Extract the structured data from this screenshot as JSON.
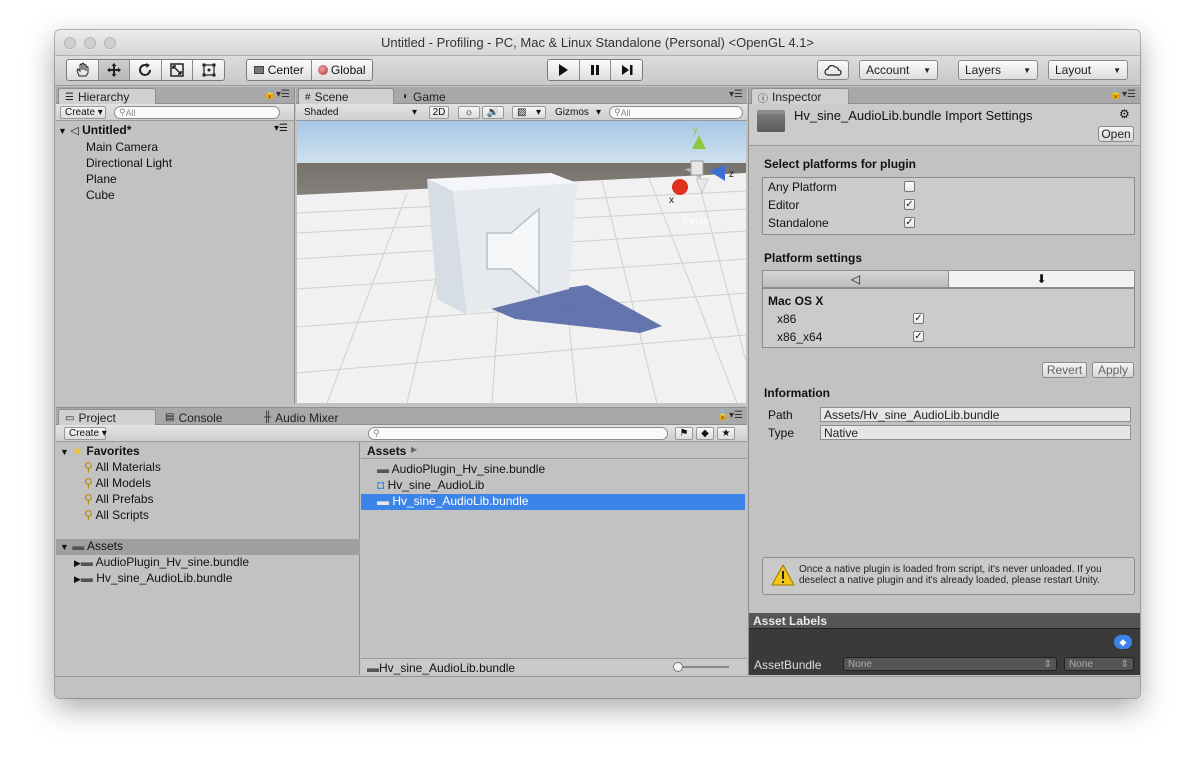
{
  "window": {
    "title": "Untitled - Profiling - PC, Mac & Linux Standalone (Personal) <OpenGL 4.1>"
  },
  "toolbar": {
    "pivot_label": "Center",
    "space_label": "Global",
    "account_label": "Account",
    "layers_label": "Layers",
    "layout_label": "Layout"
  },
  "hierarchy": {
    "tab_label": "Hierarchy",
    "create_label": "Create",
    "search_placeholder": "All",
    "scene_name": "Untitled*",
    "items": [
      "Main Camera",
      "Directional Light",
      "Plane",
      "Cube"
    ]
  },
  "scene_view": {
    "tab_scene": "Scene",
    "tab_game": "Game",
    "shading_mode": "Shaded",
    "mode_2d": "2D",
    "gizmos_label": "Gizmos",
    "search_placeholder": "All",
    "persp_label": "Persp",
    "axis_x": "x",
    "axis_y": "y",
    "axis_z": "z"
  },
  "project": {
    "tab_project": "Project",
    "tab_console": "Console",
    "tab_audio_mixer": "Audio Mixer",
    "create_label": "Create",
    "favorites_label": "Favorites",
    "favorites": [
      "All Materials",
      "All Models",
      "All Prefabs",
      "All Scripts"
    ],
    "assets_label": "Assets",
    "asset_folders": [
      "AudioPlugin_Hv_sine.bundle",
      "Hv_sine_AudioLib.bundle"
    ],
    "breadcrumb": "Assets",
    "files": [
      "AudioPlugin_Hv_sine.bundle",
      "Hv_sine_AudioLib",
      "Hv_sine_AudioLib.bundle"
    ],
    "selected_index": 2,
    "footer_path": "Hv_sine_AudioLib.bundle"
  },
  "inspector": {
    "tab_label": "Inspector",
    "header_title": "Hv_sine_AudioLib.bundle Import Settings",
    "open_label": "Open",
    "select_platforms_title": "Select platforms for plugin",
    "platforms": [
      {
        "label": "Any Platform",
        "checked": false
      },
      {
        "label": "Editor",
        "checked": true
      },
      {
        "label": "Standalone",
        "checked": true
      }
    ],
    "platform_settings_title": "Platform settings",
    "os_title": "Mac OS X",
    "archs": [
      {
        "label": "x86",
        "checked": true
      },
      {
        "label": "x86_x64",
        "checked": true
      }
    ],
    "revert_label": "Revert",
    "apply_label": "Apply",
    "information_title": "Information",
    "path_label": "Path",
    "path_value": "Assets/Hv_sine_AudioLib.bundle",
    "type_label": "Type",
    "type_value": "Native",
    "warning_text": "Once a native plugin is loaded from script, it's never unloaded. If you deselect a native plugin and it's already loaded, please restart Unity.",
    "asset_labels_title": "Asset Labels",
    "assetbundle_label": "AssetBundle",
    "assetbundle_value": "None",
    "variant_value": "None"
  },
  "colors": {
    "selection": "#3d84e8",
    "panel_bg": "#c2c2c2",
    "dark_bar": "#3a3a3a"
  }
}
